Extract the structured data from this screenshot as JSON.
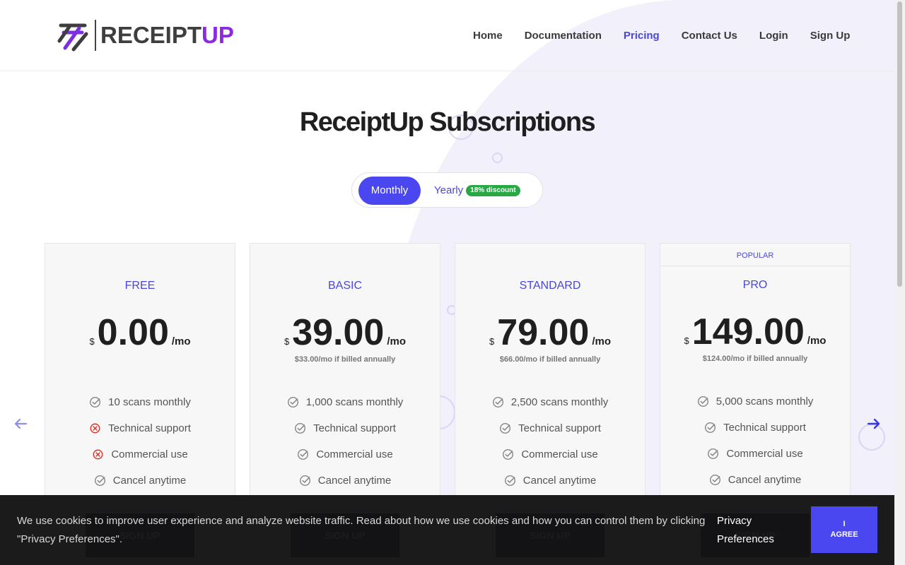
{
  "brand": {
    "name_part1": "RECEIPT",
    "name_part2": "UP"
  },
  "nav": [
    {
      "label": "Home",
      "active": false
    },
    {
      "label": "Documentation",
      "active": false
    },
    {
      "label": "Pricing",
      "active": true
    },
    {
      "label": "Contact Us",
      "active": false
    },
    {
      "label": "Login",
      "active": false
    },
    {
      "label": "Sign Up",
      "active": false
    }
  ],
  "page_title": "ReceiptUp Subscriptions",
  "billing_toggle": {
    "monthly": "Monthly",
    "yearly": "Yearly",
    "yearly_badge": "18% discount",
    "selected": "Monthly"
  },
  "plans": [
    {
      "name": "FREE",
      "currency": "$",
      "price": "0.00",
      "period": "/mo",
      "annual_note": "",
      "popular_label": "",
      "features": [
        {
          "text": "10 scans monthly",
          "included": true
        },
        {
          "text": "Technical support",
          "included": false
        },
        {
          "text": "Commercial use",
          "included": false
        },
        {
          "text": "Cancel anytime",
          "included": true
        }
      ],
      "cta": "SIGN UP"
    },
    {
      "name": "BASIC",
      "currency": "$",
      "price": "39.00",
      "period": "/mo",
      "annual_note": "$33.00/mo if billed annually",
      "popular_label": "",
      "features": [
        {
          "text": "1,000 scans monthly",
          "included": true
        },
        {
          "text": "Technical support",
          "included": true
        },
        {
          "text": "Commercial use",
          "included": true
        },
        {
          "text": "Cancel anytime",
          "included": true
        }
      ],
      "cta": "SIGN UP"
    },
    {
      "name": "STANDARD",
      "currency": "$",
      "price": "79.00",
      "period": "/mo",
      "annual_note": "$66.00/mo if billed annually",
      "popular_label": "",
      "features": [
        {
          "text": "2,500 scans monthly",
          "included": true
        },
        {
          "text": "Technical support",
          "included": true
        },
        {
          "text": "Commercial use",
          "included": true
        },
        {
          "text": "Cancel anytime",
          "included": true
        }
      ],
      "cta": "SIGN UP"
    },
    {
      "name": "PRO",
      "currency": "$",
      "price": "149.00",
      "period": "/mo",
      "annual_note": "$124.00/mo if billed annually",
      "popular_label": "POPULAR",
      "features": [
        {
          "text": "5,000 scans monthly",
          "included": true
        },
        {
          "text": "Technical support",
          "included": true
        },
        {
          "text": "Commercial use",
          "included": true
        },
        {
          "text": "Cancel anytime",
          "included": true
        }
      ],
      "cta": "SIGN UP"
    }
  ],
  "carousel": {
    "prev_icon": "arrow-left-icon",
    "next_icon": "arrow-right-icon"
  },
  "cookie_banner": {
    "message": "We use cookies to improve user experience and analyze website traffic. Read about how we use cookies and how you can control them by clicking \"Privacy Preferences\".",
    "preferences_label": "Privacy Preferences",
    "agree_label": "I AGREE"
  },
  "colors": {
    "accent": "#4a47f0",
    "accent_text": "#4a47d6",
    "brand_up": "#8a2be2",
    "discount_badge": "#28a745",
    "included_icon": "#888888",
    "excluded_icon": "#d9342b"
  }
}
